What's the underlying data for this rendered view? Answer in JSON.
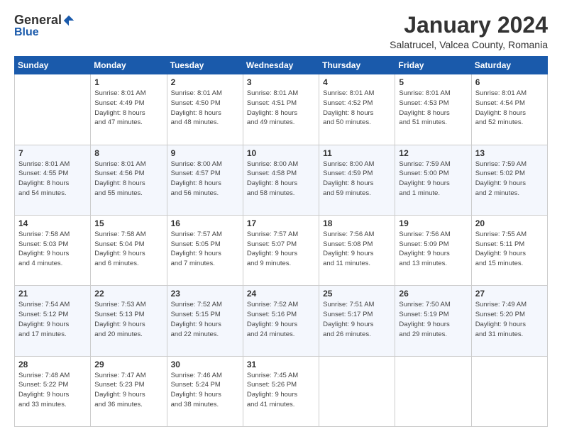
{
  "header": {
    "logo": {
      "general": "General",
      "blue": "Blue"
    },
    "title": "January 2024",
    "subtitle": "Salatrucel, Valcea County, Romania"
  },
  "weekdays": [
    "Sunday",
    "Monday",
    "Tuesday",
    "Wednesday",
    "Thursday",
    "Friday",
    "Saturday"
  ],
  "weeks": [
    [
      {
        "day": "",
        "info": ""
      },
      {
        "day": "1",
        "info": "Sunrise: 8:01 AM\nSunset: 4:49 PM\nDaylight: 8 hours\nand 47 minutes."
      },
      {
        "day": "2",
        "info": "Sunrise: 8:01 AM\nSunset: 4:50 PM\nDaylight: 8 hours\nand 48 minutes."
      },
      {
        "day": "3",
        "info": "Sunrise: 8:01 AM\nSunset: 4:51 PM\nDaylight: 8 hours\nand 49 minutes."
      },
      {
        "day": "4",
        "info": "Sunrise: 8:01 AM\nSunset: 4:52 PM\nDaylight: 8 hours\nand 50 minutes."
      },
      {
        "day": "5",
        "info": "Sunrise: 8:01 AM\nSunset: 4:53 PM\nDaylight: 8 hours\nand 51 minutes."
      },
      {
        "day": "6",
        "info": "Sunrise: 8:01 AM\nSunset: 4:54 PM\nDaylight: 8 hours\nand 52 minutes."
      }
    ],
    [
      {
        "day": "7",
        "info": "Sunrise: 8:01 AM\nSunset: 4:55 PM\nDaylight: 8 hours\nand 54 minutes."
      },
      {
        "day": "8",
        "info": "Sunrise: 8:01 AM\nSunset: 4:56 PM\nDaylight: 8 hours\nand 55 minutes."
      },
      {
        "day": "9",
        "info": "Sunrise: 8:00 AM\nSunset: 4:57 PM\nDaylight: 8 hours\nand 56 minutes."
      },
      {
        "day": "10",
        "info": "Sunrise: 8:00 AM\nSunset: 4:58 PM\nDaylight: 8 hours\nand 58 minutes."
      },
      {
        "day": "11",
        "info": "Sunrise: 8:00 AM\nSunset: 4:59 PM\nDaylight: 8 hours\nand 59 minutes."
      },
      {
        "day": "12",
        "info": "Sunrise: 7:59 AM\nSunset: 5:00 PM\nDaylight: 9 hours\nand 1 minute."
      },
      {
        "day": "13",
        "info": "Sunrise: 7:59 AM\nSunset: 5:02 PM\nDaylight: 9 hours\nand 2 minutes."
      }
    ],
    [
      {
        "day": "14",
        "info": "Sunrise: 7:58 AM\nSunset: 5:03 PM\nDaylight: 9 hours\nand 4 minutes."
      },
      {
        "day": "15",
        "info": "Sunrise: 7:58 AM\nSunset: 5:04 PM\nDaylight: 9 hours\nand 6 minutes."
      },
      {
        "day": "16",
        "info": "Sunrise: 7:57 AM\nSunset: 5:05 PM\nDaylight: 9 hours\nand 7 minutes."
      },
      {
        "day": "17",
        "info": "Sunrise: 7:57 AM\nSunset: 5:07 PM\nDaylight: 9 hours\nand 9 minutes."
      },
      {
        "day": "18",
        "info": "Sunrise: 7:56 AM\nSunset: 5:08 PM\nDaylight: 9 hours\nand 11 minutes."
      },
      {
        "day": "19",
        "info": "Sunrise: 7:56 AM\nSunset: 5:09 PM\nDaylight: 9 hours\nand 13 minutes."
      },
      {
        "day": "20",
        "info": "Sunrise: 7:55 AM\nSunset: 5:11 PM\nDaylight: 9 hours\nand 15 minutes."
      }
    ],
    [
      {
        "day": "21",
        "info": "Sunrise: 7:54 AM\nSunset: 5:12 PM\nDaylight: 9 hours\nand 17 minutes."
      },
      {
        "day": "22",
        "info": "Sunrise: 7:53 AM\nSunset: 5:13 PM\nDaylight: 9 hours\nand 20 minutes."
      },
      {
        "day": "23",
        "info": "Sunrise: 7:52 AM\nSunset: 5:15 PM\nDaylight: 9 hours\nand 22 minutes."
      },
      {
        "day": "24",
        "info": "Sunrise: 7:52 AM\nSunset: 5:16 PM\nDaylight: 9 hours\nand 24 minutes."
      },
      {
        "day": "25",
        "info": "Sunrise: 7:51 AM\nSunset: 5:17 PM\nDaylight: 9 hours\nand 26 minutes."
      },
      {
        "day": "26",
        "info": "Sunrise: 7:50 AM\nSunset: 5:19 PM\nDaylight: 9 hours\nand 29 minutes."
      },
      {
        "day": "27",
        "info": "Sunrise: 7:49 AM\nSunset: 5:20 PM\nDaylight: 9 hours\nand 31 minutes."
      }
    ],
    [
      {
        "day": "28",
        "info": "Sunrise: 7:48 AM\nSunset: 5:22 PM\nDaylight: 9 hours\nand 33 minutes."
      },
      {
        "day": "29",
        "info": "Sunrise: 7:47 AM\nSunset: 5:23 PM\nDaylight: 9 hours\nand 36 minutes."
      },
      {
        "day": "30",
        "info": "Sunrise: 7:46 AM\nSunset: 5:24 PM\nDaylight: 9 hours\nand 38 minutes."
      },
      {
        "day": "31",
        "info": "Sunrise: 7:45 AM\nSunset: 5:26 PM\nDaylight: 9 hours\nand 41 minutes."
      },
      {
        "day": "",
        "info": ""
      },
      {
        "day": "",
        "info": ""
      },
      {
        "day": "",
        "info": ""
      }
    ]
  ]
}
